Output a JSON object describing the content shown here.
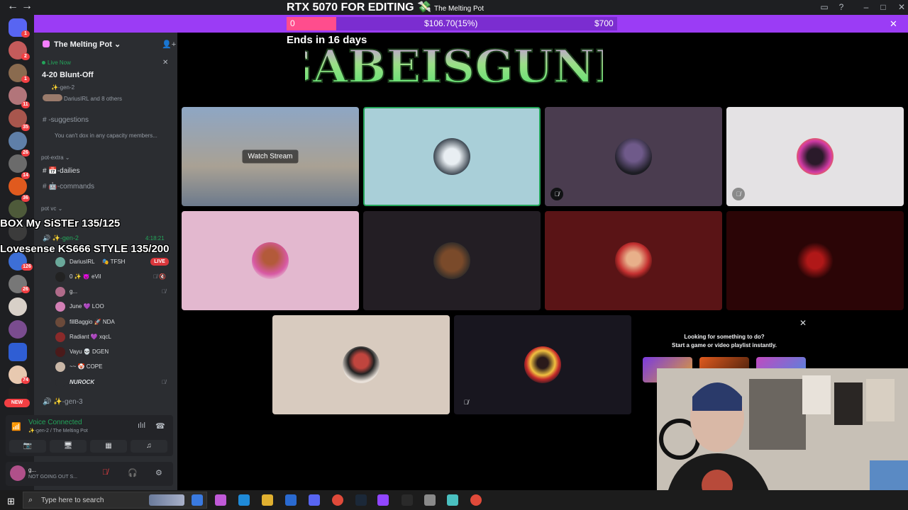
{
  "window": {
    "title": "RTX 5070 FOR EDITING 💸 The Melting Pot"
  },
  "goal": {
    "title": "RTX 5070 FOR EDITING",
    "title_emoji": "💸",
    "subtitle": "The Melting Pot",
    "start": "0",
    "current": "$106.70(15%)",
    "target": "$700",
    "progress_fraction": 0.15,
    "ends": "Ends in 16 days",
    "accent_color": "#9b3cf5",
    "fill_color": "#ff4d8d"
  },
  "logo_text": "GABEISGUNK",
  "rail": {
    "badges": [
      "1",
      "2",
      "1",
      "11",
      "35",
      "26",
      "14",
      "36",
      "126",
      "26",
      "74"
    ],
    "new_label": "NEW"
  },
  "server": {
    "name": "The Melting Pot"
  },
  "live_event": {
    "label": "Live Now",
    "title": "4-20 Blunt-Off",
    "channel": "✨-gen-2",
    "attendees": "DariusIRL and 8 others"
  },
  "channels": {
    "suggestions": "-suggestions",
    "suggestions_preview": "You can't dox in any capacity members...",
    "cat_extra": "pot-extra",
    "dailies": "-dailies",
    "commands": "-commands",
    "cat_vc": "pot vc",
    "gen2": "✨-gen-2",
    "gen2_time": "4:18:21",
    "gen3": "✨-gen-3"
  },
  "overlay": {
    "line1": "BOX My SiSTEr 135/125",
    "line2": "Lovesense KS666 STYLE 135/200"
  },
  "voice_users": [
    {
      "name": "DariusIRL",
      "tag": "TFSH"
    },
    {
      "name": "0 ✨",
      "tag": "eVil"
    },
    {
      "name": "g...",
      "tag": ""
    },
    {
      "name": "June",
      "tag": "LOO"
    },
    {
      "name": "fillBaggio",
      "tag": "NDA"
    },
    {
      "name": "Radiant",
      "tag": "xqcL"
    },
    {
      "name": "Vayu",
      "tag": "DGEN"
    },
    {
      "name": "~~",
      "tag": "COPE"
    },
    {
      "name": "NUROCK",
      "tag": ""
    }
  ],
  "live_badge": "LIVE",
  "voice": {
    "status": "Voice Connected",
    "location": "✨-gen-2 / The Melting Pot"
  },
  "userbar": {
    "name": "g...",
    "status": "NOT GOING OUT S..."
  },
  "stage": {
    "watch_stream": "Watch Stream"
  },
  "activity": {
    "line1": "Looking for something to do?",
    "line2": "Start a game or video playlist instantly."
  },
  "taskbar": {
    "search_placeholder": "Type here to search"
  }
}
